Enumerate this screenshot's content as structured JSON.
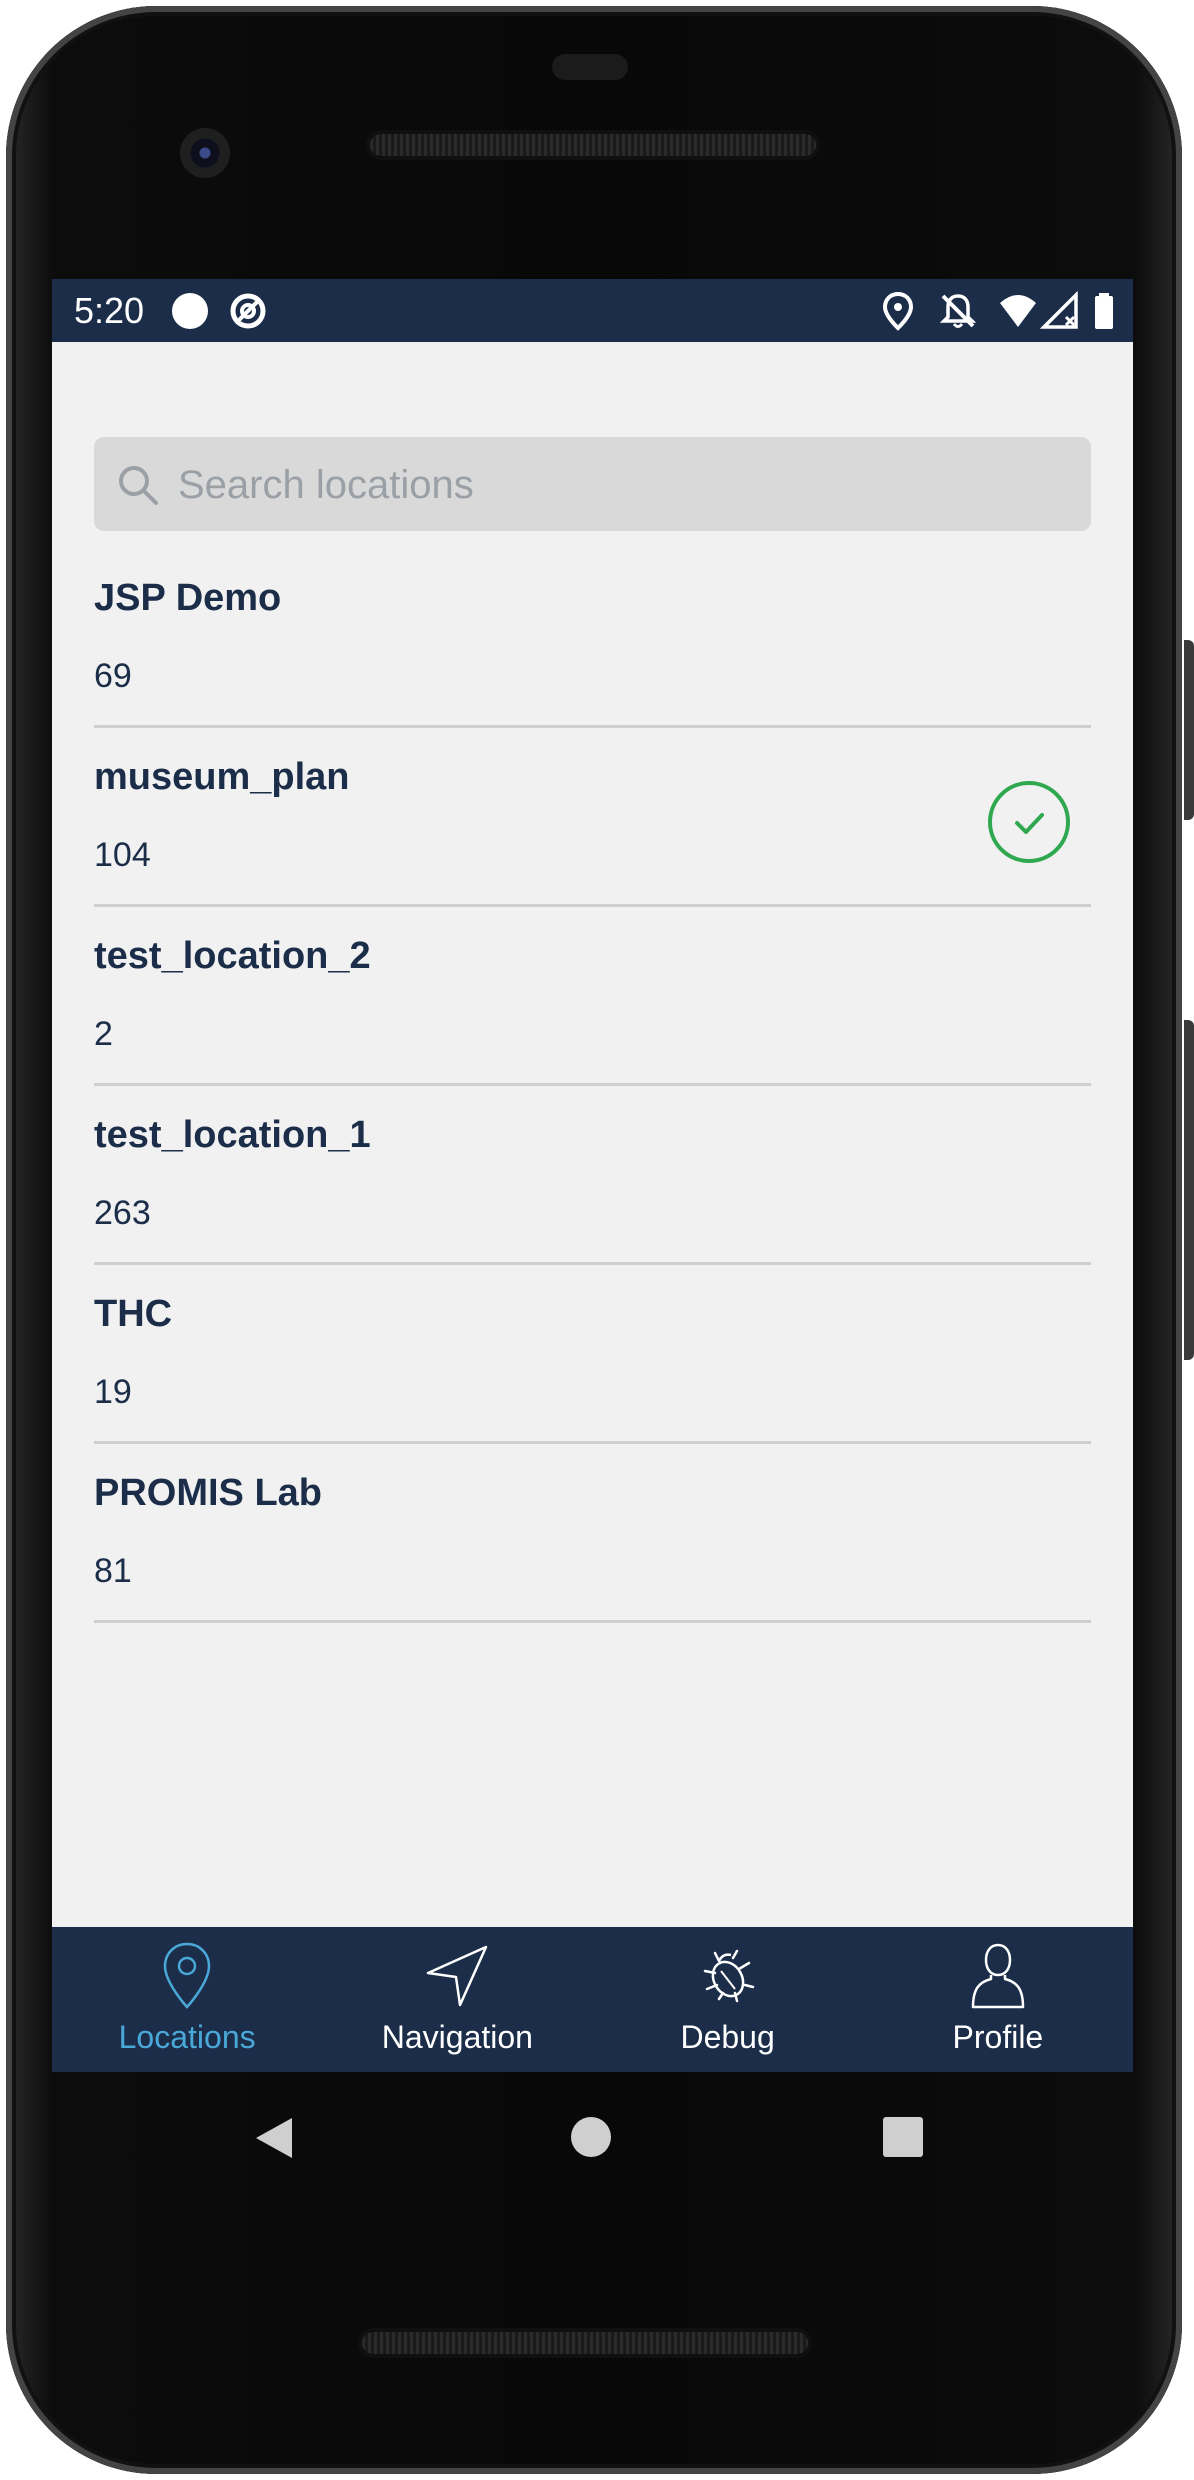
{
  "status_bar": {
    "time": "5:20"
  },
  "search": {
    "placeholder": "Search locations",
    "value": ""
  },
  "locations": [
    {
      "name": "JSP Demo",
      "count": "69",
      "selected": false
    },
    {
      "name": "museum_plan",
      "count": "104",
      "selected": true
    },
    {
      "name": "test_location_2",
      "count": "2",
      "selected": false
    },
    {
      "name": "test_location_1",
      "count": "263",
      "selected": false
    },
    {
      "name": "THC",
      "count": "19",
      "selected": false
    },
    {
      "name": "PROMIS Lab",
      "count": "81",
      "selected": false
    }
  ],
  "bottom_nav": {
    "items": [
      {
        "label": "Locations",
        "icon": "location-pin-icon",
        "active": true
      },
      {
        "label": "Navigation",
        "icon": "navigation-arrow-icon",
        "active": false
      },
      {
        "label": "Debug",
        "icon": "bug-icon",
        "active": false
      },
      {
        "label": "Profile",
        "icon": "person-icon",
        "active": false
      }
    ]
  },
  "colors": {
    "header_bg": "#1b2d48",
    "screen_bg": "#f1f1f1",
    "active_tab": "#4aa8d8",
    "selected_check": "#2fa84f"
  }
}
